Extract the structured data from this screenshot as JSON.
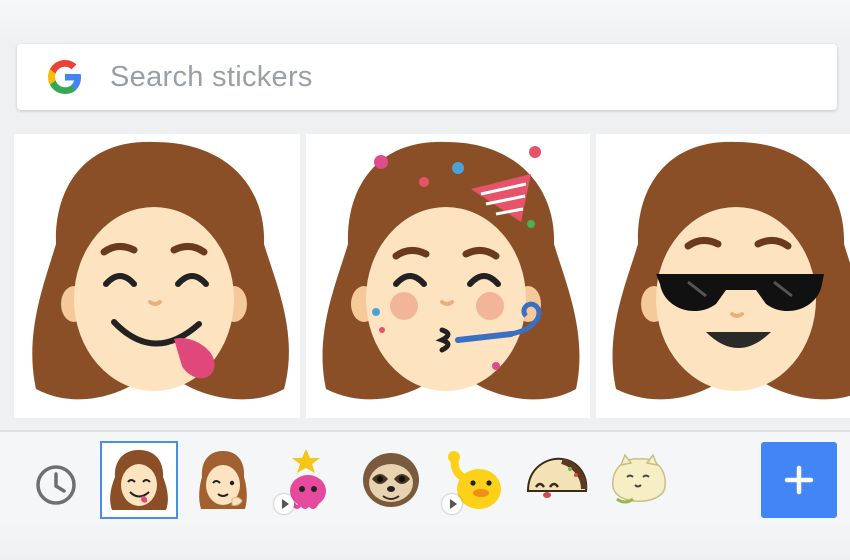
{
  "search": {
    "placeholder": "Search stickers"
  },
  "stickers": [
    {
      "icon": "silly-tongue-face-sticker"
    },
    {
      "icon": "party-kiss-face-sticker"
    },
    {
      "icon": "sunglasses-face-sticker"
    }
  ],
  "tray": {
    "recent_icon": "clock-icon",
    "packs": [
      {
        "icon": "bitmoji-avatar-icon",
        "selected": true
      },
      {
        "icon": "bitmoji-wink-icon"
      },
      {
        "icon": "pink-octopus-icon",
        "animated": true
      },
      {
        "icon": "sloth-icon"
      },
      {
        "icon": "yellow-duck-icon",
        "animated": true
      },
      {
        "icon": "taco-icon"
      },
      {
        "icon": "mochi-cat-icon"
      }
    ],
    "add_icon": "plus-icon"
  },
  "colors": {
    "accent": "#4285f4",
    "hair": "#8a4f26",
    "skin": "#fde3c0",
    "background": "#eef0f2"
  }
}
